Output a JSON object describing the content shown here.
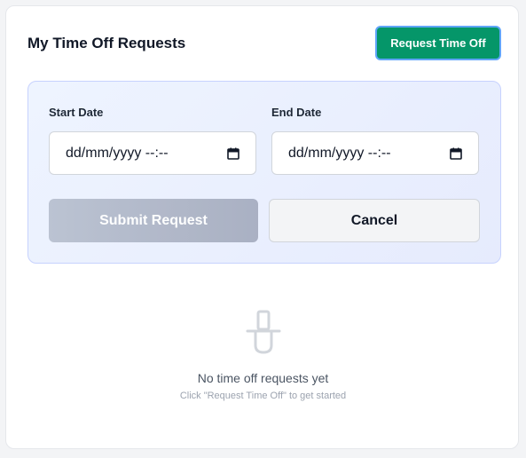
{
  "header": {
    "title": "My Time Off Requests",
    "request_button_label": "Request Time Off"
  },
  "form": {
    "start_date": {
      "label": "Start Date",
      "value": "dd/mm/yyyy --:--",
      "icon": "calendar-icon"
    },
    "end_date": {
      "label": "End Date",
      "value": "dd/mm/yyyy --:--",
      "icon": "calendar-icon"
    },
    "submit_label": "Submit Request",
    "cancel_label": "Cancel"
  },
  "empty_state": {
    "icon": "empty-requests-icon",
    "title": "No time off requests yet",
    "subtitle": "Click \"Request Time Off\" to get started"
  },
  "colors": {
    "primary": "#059669",
    "panel_bg": "#eef4ff",
    "panel_border": "#c7d2fe",
    "submit_disabled": "#b9c1d0"
  }
}
